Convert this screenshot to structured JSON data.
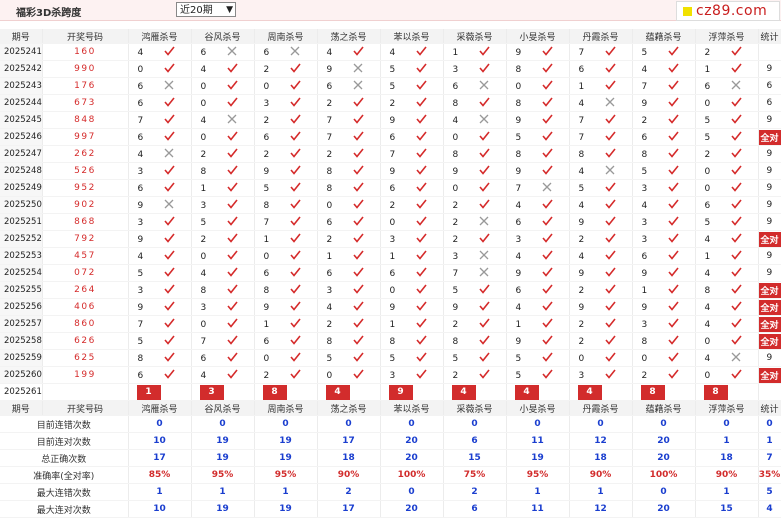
{
  "header": {
    "title": "福彩3D杀跨度",
    "select_value": "近20期",
    "logo_text": "cz89.com"
  },
  "columns": [
    "期号",
    "开奖号码",
    "鸿雁杀号",
    "谷风杀号",
    "周南杀号",
    "荡之杀号",
    "苯以杀号",
    "采薇杀号",
    "小旻杀号",
    "丹霞杀号",
    "蕴藉杀号",
    "浮萍杀号",
    "统计"
  ],
  "rows": [
    {
      "p": "2025241",
      "n": "160",
      "v": [
        [
          "4",
          "y"
        ],
        [
          "6",
          "n"
        ],
        [
          "6",
          "n"
        ],
        [
          "4",
          "y"
        ],
        [
          "4",
          "y"
        ],
        [
          "1",
          "y"
        ],
        [
          "9",
          "y"
        ],
        [
          "7",
          "y"
        ],
        [
          "5",
          "y"
        ],
        [
          "2",
          "y"
        ]
      ],
      "s": ""
    },
    {
      "p": "2025242",
      "n": "990",
      "v": [
        [
          "0",
          "y"
        ],
        [
          "4",
          "y"
        ],
        [
          "2",
          "y"
        ],
        [
          "9",
          "n"
        ],
        [
          "5",
          "y"
        ],
        [
          "3",
          "y"
        ],
        [
          "8",
          "y"
        ],
        [
          "6",
          "y"
        ],
        [
          "4",
          "y"
        ],
        [
          "1",
          "y"
        ]
      ],
      "s": "9"
    },
    {
      "p": "2025243",
      "n": "176",
      "v": [
        [
          "6",
          "n"
        ],
        [
          "0",
          "y"
        ],
        [
          "0",
          "y"
        ],
        [
          "6",
          "n"
        ],
        [
          "5",
          "y"
        ],
        [
          "6",
          "n"
        ],
        [
          "0",
          "y"
        ],
        [
          "1",
          "y"
        ],
        [
          "7",
          "y"
        ],
        [
          "6",
          "n"
        ]
      ],
      "s": "6"
    },
    {
      "p": "2025244",
      "n": "673",
      "v": [
        [
          "6",
          "y"
        ],
        [
          "0",
          "y"
        ],
        [
          "3",
          "y"
        ],
        [
          "2",
          "y"
        ],
        [
          "2",
          "y"
        ],
        [
          "8",
          "y"
        ],
        [
          "8",
          "y"
        ],
        [
          "4",
          "n"
        ],
        [
          "9",
          "y"
        ],
        [
          "0",
          "y"
        ]
      ],
      "s": "6"
    },
    {
      "p": "2025245",
      "n": "848",
      "v": [
        [
          "7",
          "y"
        ],
        [
          "4",
          "n"
        ],
        [
          "2",
          "y"
        ],
        [
          "7",
          "y"
        ],
        [
          "9",
          "y"
        ],
        [
          "4",
          "n"
        ],
        [
          "9",
          "y"
        ],
        [
          "7",
          "y"
        ],
        [
          "2",
          "y"
        ],
        [
          "5",
          "y"
        ]
      ],
      "s": "9"
    },
    {
      "p": "2025246",
      "n": "997",
      "v": [
        [
          "6",
          "y"
        ],
        [
          "0",
          "y"
        ],
        [
          "6",
          "y"
        ],
        [
          "7",
          "y"
        ],
        [
          "6",
          "y"
        ],
        [
          "0",
          "y"
        ],
        [
          "5",
          "y"
        ],
        [
          "7",
          "y"
        ],
        [
          "6",
          "y"
        ],
        [
          "5",
          "y"
        ]
      ],
      "s": "全对"
    },
    {
      "p": "2025247",
      "n": "262",
      "v": [
        [
          "4",
          "n"
        ],
        [
          "2",
          "y"
        ],
        [
          "2",
          "y"
        ],
        [
          "2",
          "y"
        ],
        [
          "7",
          "y"
        ],
        [
          "8",
          "y"
        ],
        [
          "8",
          "y"
        ],
        [
          "8",
          "y"
        ],
        [
          "8",
          "y"
        ],
        [
          "2",
          "y"
        ]
      ],
      "s": "9"
    },
    {
      "p": "2025248",
      "n": "526",
      "v": [
        [
          "3",
          "y"
        ],
        [
          "8",
          "y"
        ],
        [
          "9",
          "y"
        ],
        [
          "8",
          "y"
        ],
        [
          "9",
          "y"
        ],
        [
          "9",
          "y"
        ],
        [
          "9",
          "y"
        ],
        [
          "4",
          "n"
        ],
        [
          "5",
          "y"
        ],
        [
          "0",
          "y"
        ]
      ],
      "s": "9"
    },
    {
      "p": "2025249",
      "n": "952",
      "v": [
        [
          "6",
          "y"
        ],
        [
          "1",
          "y"
        ],
        [
          "5",
          "y"
        ],
        [
          "8",
          "y"
        ],
        [
          "6",
          "y"
        ],
        [
          "0",
          "y"
        ],
        [
          "7",
          "n"
        ],
        [
          "5",
          "y"
        ],
        [
          "3",
          "y"
        ],
        [
          "0",
          "y"
        ]
      ],
      "s": "9"
    },
    {
      "p": "2025250",
      "n": "902",
      "v": [
        [
          "9",
          "n"
        ],
        [
          "3",
          "y"
        ],
        [
          "8",
          "y"
        ],
        [
          "0",
          "y"
        ],
        [
          "2",
          "y"
        ],
        [
          "2",
          "y"
        ],
        [
          "4",
          "y"
        ],
        [
          "4",
          "y"
        ],
        [
          "4",
          "y"
        ],
        [
          "6",
          "y"
        ]
      ],
      "s": "9"
    },
    {
      "p": "2025251",
      "n": "868",
      "v": [
        [
          "3",
          "y"
        ],
        [
          "5",
          "y"
        ],
        [
          "7",
          "y"
        ],
        [
          "6",
          "y"
        ],
        [
          "0",
          "y"
        ],
        [
          "2",
          "n"
        ],
        [
          "6",
          "y"
        ],
        [
          "9",
          "y"
        ],
        [
          "3",
          "y"
        ],
        [
          "5",
          "y"
        ]
      ],
      "s": "9"
    },
    {
      "p": "2025252",
      "n": "792",
      "v": [
        [
          "9",
          "y"
        ],
        [
          "2",
          "y"
        ],
        [
          "1",
          "y"
        ],
        [
          "2",
          "y"
        ],
        [
          "3",
          "y"
        ],
        [
          "2",
          "y"
        ],
        [
          "3",
          "y"
        ],
        [
          "2",
          "y"
        ],
        [
          "3",
          "y"
        ],
        [
          "4",
          "y"
        ]
      ],
      "s": "全对"
    },
    {
      "p": "2025253",
      "n": "457",
      "v": [
        [
          "4",
          "y"
        ],
        [
          "0",
          "y"
        ],
        [
          "0",
          "y"
        ],
        [
          "1",
          "y"
        ],
        [
          "1",
          "y"
        ],
        [
          "3",
          "n"
        ],
        [
          "4",
          "y"
        ],
        [
          "4",
          "y"
        ],
        [
          "6",
          "y"
        ],
        [
          "1",
          "y"
        ]
      ],
      "s": "9"
    },
    {
      "p": "2025254",
      "n": "072",
      "v": [
        [
          "5",
          "y"
        ],
        [
          "4",
          "y"
        ],
        [
          "6",
          "y"
        ],
        [
          "6",
          "y"
        ],
        [
          "6",
          "y"
        ],
        [
          "7",
          "n"
        ],
        [
          "9",
          "y"
        ],
        [
          "9",
          "y"
        ],
        [
          "9",
          "y"
        ],
        [
          "4",
          "y"
        ]
      ],
      "s": "9"
    },
    {
      "p": "2025255",
      "n": "264",
      "v": [
        [
          "3",
          "y"
        ],
        [
          "8",
          "y"
        ],
        [
          "8",
          "y"
        ],
        [
          "3",
          "y"
        ],
        [
          "0",
          "y"
        ],
        [
          "5",
          "y"
        ],
        [
          "6",
          "y"
        ],
        [
          "2",
          "y"
        ],
        [
          "1",
          "y"
        ],
        [
          "8",
          "y"
        ]
      ],
      "s": "全对"
    },
    {
      "p": "2025256",
      "n": "406",
      "v": [
        [
          "9",
          "y"
        ],
        [
          "3",
          "y"
        ],
        [
          "9",
          "y"
        ],
        [
          "4",
          "y"
        ],
        [
          "9",
          "y"
        ],
        [
          "9",
          "y"
        ],
        [
          "4",
          "y"
        ],
        [
          "9",
          "y"
        ],
        [
          "9",
          "y"
        ],
        [
          "4",
          "y"
        ]
      ],
      "s": "全对"
    },
    {
      "p": "2025257",
      "n": "860",
      "v": [
        [
          "7",
          "y"
        ],
        [
          "0",
          "y"
        ],
        [
          "1",
          "y"
        ],
        [
          "2",
          "y"
        ],
        [
          "1",
          "y"
        ],
        [
          "2",
          "y"
        ],
        [
          "1",
          "y"
        ],
        [
          "2",
          "y"
        ],
        [
          "3",
          "y"
        ],
        [
          "4",
          "y"
        ]
      ],
      "s": "全对"
    },
    {
      "p": "2025258",
      "n": "626",
      "v": [
        [
          "5",
          "y"
        ],
        [
          "7",
          "y"
        ],
        [
          "6",
          "y"
        ],
        [
          "8",
          "y"
        ],
        [
          "8",
          "y"
        ],
        [
          "8",
          "y"
        ],
        [
          "9",
          "y"
        ],
        [
          "2",
          "y"
        ],
        [
          "8",
          "y"
        ],
        [
          "0",
          "y"
        ]
      ],
      "s": "全对"
    },
    {
      "p": "2025259",
      "n": "625",
      "v": [
        [
          "8",
          "y"
        ],
        [
          "6",
          "y"
        ],
        [
          "0",
          "y"
        ],
        [
          "5",
          "y"
        ],
        [
          "5",
          "y"
        ],
        [
          "5",
          "y"
        ],
        [
          "5",
          "y"
        ],
        [
          "0",
          "y"
        ],
        [
          "0",
          "y"
        ],
        [
          "4",
          "n"
        ]
      ],
      "s": "9"
    },
    {
      "p": "2025260",
      "n": "199",
      "v": [
        [
          "6",
          "y"
        ],
        [
          "4",
          "y"
        ],
        [
          "2",
          "y"
        ],
        [
          "0",
          "y"
        ],
        [
          "3",
          "y"
        ],
        [
          "2",
          "y"
        ],
        [
          "5",
          "y"
        ],
        [
          "3",
          "y"
        ],
        [
          "2",
          "y"
        ],
        [
          "0",
          "y"
        ]
      ],
      "s": "全对"
    }
  ],
  "current": {
    "p": "2025261",
    "label": "当前期杀号",
    "v": [
      "1",
      "3",
      "8",
      "4",
      "9",
      "4",
      "4",
      "4",
      "8",
      "8"
    ]
  },
  "stats": [
    {
      "label": "目前连错次数",
      "cls": "sv",
      "v": [
        "0",
        "0",
        "0",
        "0",
        "0",
        "0",
        "0",
        "0",
        "0",
        "0",
        "0"
      ]
    },
    {
      "label": "目前连对次数",
      "cls": "sv",
      "v": [
        "10",
        "19",
        "19",
        "17",
        "20",
        "6",
        "11",
        "12",
        "20",
        "1",
        "1"
      ]
    },
    {
      "label": "总正确次数",
      "cls": "sv",
      "v": [
        "17",
        "19",
        "19",
        "18",
        "20",
        "15",
        "19",
        "18",
        "20",
        "18",
        "7"
      ]
    },
    {
      "label": "准确率(全对率)",
      "cls": "sr",
      "v": [
        "85%",
        "95%",
        "95%",
        "90%",
        "100%",
        "75%",
        "95%",
        "90%",
        "100%",
        "90%",
        "35%"
      ]
    },
    {
      "label": "最大连错次数",
      "cls": "sv",
      "v": [
        "1",
        "1",
        "1",
        "2",
        "0",
        "2",
        "1",
        "1",
        "0",
        "1",
        "5"
      ]
    },
    {
      "label": "最大连对次数",
      "cls": "sv",
      "v": [
        "10",
        "19",
        "19",
        "17",
        "20",
        "6",
        "11",
        "12",
        "20",
        "15",
        "4"
      ]
    }
  ]
}
